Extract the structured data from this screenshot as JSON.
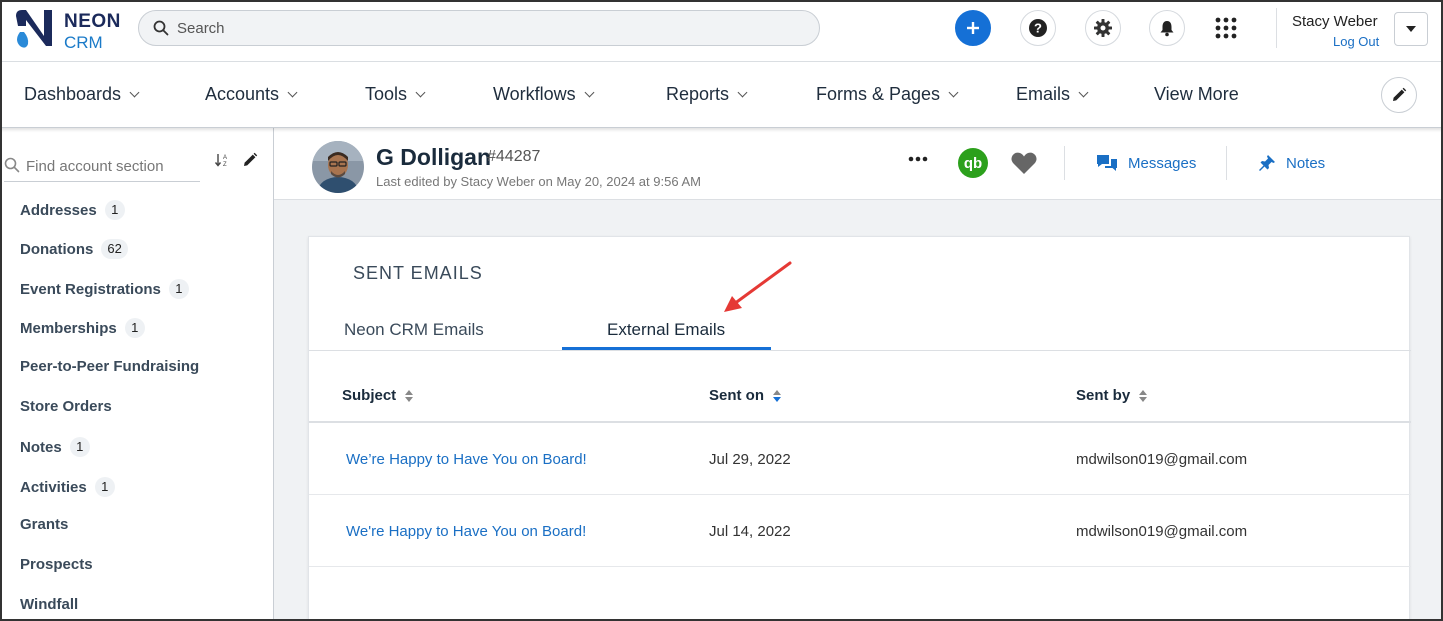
{
  "brand": {
    "line1": "NEON",
    "line2": "CRM"
  },
  "search": {
    "placeholder": "Search"
  },
  "user": {
    "name": "Stacy Weber",
    "logout": "Log Out"
  },
  "nav": [
    {
      "label": "Dashboards"
    },
    {
      "label": "Accounts"
    },
    {
      "label": "Tools"
    },
    {
      "label": "Workflows"
    },
    {
      "label": "Reports"
    },
    {
      "label": "Forms & Pages"
    },
    {
      "label": "Emails"
    },
    {
      "label": "View More"
    }
  ],
  "sidebar": {
    "search_placeholder": "Find account section",
    "items": [
      {
        "label": "Addresses",
        "count": "1"
      },
      {
        "label": "Donations",
        "count": "62"
      },
      {
        "label": "Event Registrations",
        "count": "1"
      },
      {
        "label": "Memberships",
        "count": "1"
      },
      {
        "label": "Peer-to-Peer Fundraising",
        "count": ""
      },
      {
        "label": "Store Orders",
        "count": ""
      },
      {
        "label": "Notes",
        "count": "1"
      },
      {
        "label": "Activities",
        "count": "1"
      },
      {
        "label": "Grants",
        "count": ""
      },
      {
        "label": "Prospects",
        "count": ""
      },
      {
        "label": "Windfall",
        "count": ""
      }
    ]
  },
  "account": {
    "name": "G Dolligan",
    "id": "#44287",
    "edited": "Last edited by Stacy Weber on May 20, 2024 at 9:56 AM",
    "qb_label": "qb",
    "messages": "Messages",
    "notes": "Notes"
  },
  "sent_emails": {
    "title": "SENT EMAILS",
    "tabs": [
      {
        "label": "Neon CRM Emails",
        "active": false
      },
      {
        "label": "External Emails",
        "active": true
      }
    ],
    "columns": [
      "Subject",
      "Sent on",
      "Sent by"
    ],
    "rows": [
      {
        "subject": "We’re Happy to Have You on Board!",
        "sent_on": "Jul 29, 2022",
        "sent_by": "mdwilson019@gmail.com"
      },
      {
        "subject": "We're Happy to Have You on Board!",
        "sent_on": "Jul 14, 2022",
        "sent_by": "mdwilson019@gmail.com"
      }
    ]
  },
  "colors": {
    "accent": "#1570d6",
    "link": "#1a6fc4",
    "brand_dark": "#1b2a5b",
    "quickbooks": "#2ca01c",
    "annotation_arrow": "#e53935"
  },
  "icons": [
    "search-icon",
    "plus-icon",
    "help-icon",
    "gear-icon",
    "bell-icon",
    "apps-grid-icon",
    "chevron-down-icon",
    "pencil-icon",
    "sort-icon",
    "more-icon",
    "quickbooks-icon",
    "heart-icon",
    "messages-icon",
    "pin-icon"
  ]
}
